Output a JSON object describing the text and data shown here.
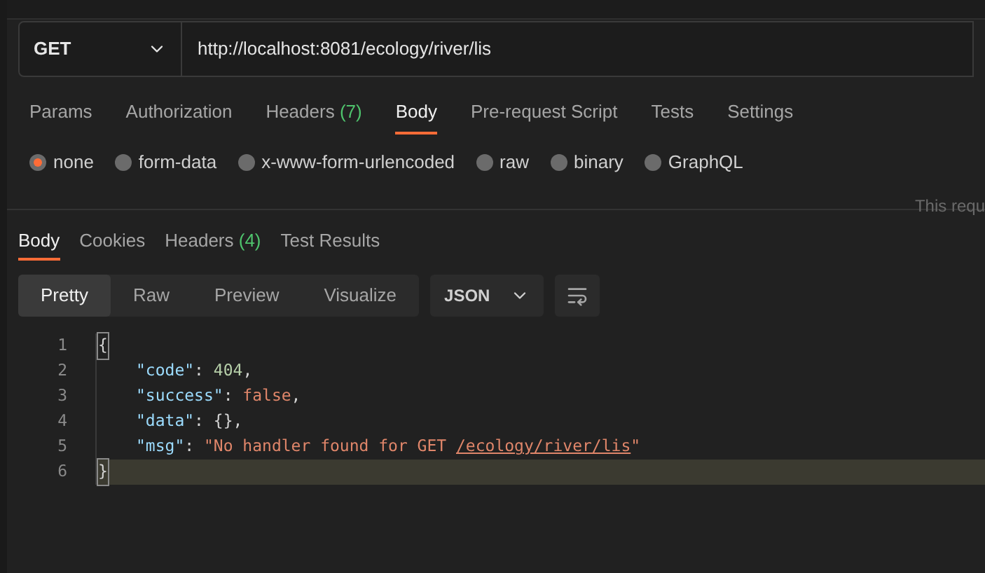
{
  "request": {
    "method": "GET",
    "url": "http://localhost:8081/ecology/river/lis"
  },
  "request_tabs": [
    {
      "label": "Params",
      "selected": false
    },
    {
      "label": "Authorization",
      "selected": false
    },
    {
      "label": "Headers",
      "count": "(7)",
      "selected": false
    },
    {
      "label": "Body",
      "selected": true
    },
    {
      "label": "Pre-request Script",
      "selected": false
    },
    {
      "label": "Tests",
      "selected": false
    },
    {
      "label": "Settings",
      "selected": false
    }
  ],
  "body_types": [
    {
      "label": "none",
      "selected": true
    },
    {
      "label": "form-data",
      "selected": false
    },
    {
      "label": "x-www-form-urlencoded",
      "selected": false
    },
    {
      "label": "raw",
      "selected": false
    },
    {
      "label": "binary",
      "selected": false
    },
    {
      "label": "GraphQL",
      "selected": false
    }
  ],
  "body_note": "This requ",
  "response_tabs": [
    {
      "label": "Body",
      "selected": true
    },
    {
      "label": "Cookies",
      "selected": false
    },
    {
      "label": "Headers",
      "count": "(4)",
      "selected": false
    },
    {
      "label": "Test Results",
      "selected": false
    }
  ],
  "view_modes": [
    {
      "label": "Pretty",
      "selected": true
    },
    {
      "label": "Raw",
      "selected": false
    },
    {
      "label": "Preview",
      "selected": false
    },
    {
      "label": "Visualize",
      "selected": false
    }
  ],
  "format": "JSON",
  "code_lines": [
    {
      "number": "1",
      "indented": false,
      "current": false,
      "tokens": [
        {
          "text": "{",
          "kind": "bracket"
        }
      ]
    },
    {
      "number": "2",
      "indented": true,
      "current": false,
      "tokens": [
        {
          "text": "\"code\"",
          "kind": "key"
        },
        {
          "text": ": ",
          "kind": "punct"
        },
        {
          "text": "404",
          "kind": "number"
        },
        {
          "text": ",",
          "kind": "punct"
        }
      ]
    },
    {
      "number": "3",
      "indented": true,
      "current": false,
      "tokens": [
        {
          "text": "\"success\"",
          "kind": "key"
        },
        {
          "text": ": ",
          "kind": "punct"
        },
        {
          "text": "false",
          "kind": "boolean"
        },
        {
          "text": ",",
          "kind": "punct"
        }
      ]
    },
    {
      "number": "4",
      "indented": true,
      "current": false,
      "tokens": [
        {
          "text": "\"data\"",
          "kind": "key"
        },
        {
          "text": ": ",
          "kind": "punct"
        },
        {
          "text": "{}",
          "kind": "punct"
        },
        {
          "text": ",",
          "kind": "punct"
        }
      ]
    },
    {
      "number": "5",
      "indented": true,
      "current": false,
      "tokens": [
        {
          "text": "\"msg\"",
          "kind": "key"
        },
        {
          "text": ": ",
          "kind": "punct"
        },
        {
          "text": "\"No handler found for GET ",
          "kind": "string"
        },
        {
          "text": "/ecology/river/lis",
          "kind": "link"
        },
        {
          "text": "\"",
          "kind": "string"
        }
      ]
    },
    {
      "number": "6",
      "indented": false,
      "current": true,
      "tokens": [
        {
          "text": "}",
          "kind": "bracket"
        }
      ]
    }
  ]
}
